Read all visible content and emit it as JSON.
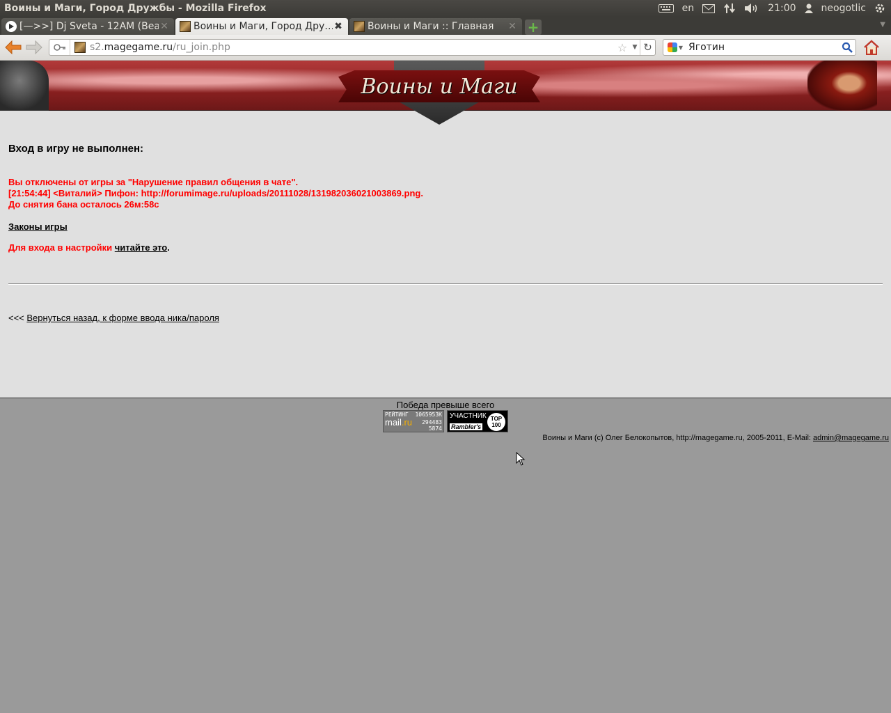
{
  "window": {
    "title": "Воины и Маги, Город Дружбы - Mozilla Firefox",
    "keyboard_layout": "en",
    "clock": "21:00",
    "user": "neogotlic",
    "tray_icons": [
      "keyboard-icon",
      "mail-icon",
      "network-icon",
      "volume-icon",
      "user-icon",
      "power-gear-icon"
    ]
  },
  "tabs": [
    {
      "label": "[—>>] Dj Sveta - 12AM (Bea…",
      "favicon": "play-icon",
      "active": false
    },
    {
      "label": "Воины и Маги, Город Дру…",
      "favicon": "game-favicon",
      "active": true
    },
    {
      "label": "Воины и Маги :: Главная",
      "favicon": "game-favicon",
      "active": false
    }
  ],
  "navbar": {
    "url_prefix": "s2.",
    "url_domain": "magegame.ru",
    "url_path": "/ru_join.php",
    "search_value": "Яготин",
    "search_engine": "google"
  },
  "banner": {
    "logo_text": "Воины и Маги"
  },
  "content": {
    "heading": "Вход в игру не выполнен:",
    "ban_line1": "Вы отключены от игры за \"Нарушение правил общения в чате\".",
    "ban_line2": "[21:54:44] <Виталий> Пифон: http://forumimage.ru/uploads/20111028/131982036021003869.png.",
    "ban_line3": "До снятия бана осталось 26м:58с",
    "rules_link": "Законы игры",
    "settings_prefix": "Для входа в настройки ",
    "settings_link": "читайте это",
    "settings_suffix": ".",
    "back_prefix": "<<< ",
    "back_link": "Вернуться назад, к форме ввода ника/пароля"
  },
  "footer": {
    "motto": "Победа превыше всего",
    "mail_counter": {
      "title": "РЕЙТИНГ",
      "value1": "1065953К",
      "brand_a": "mail",
      "brand_b": ".ru",
      "value2": "294483",
      "value3": "5874"
    },
    "rambler_counter": {
      "top_text": "УЧАСТНИК",
      "bottom_text": "Rambler's",
      "badge_line1": "TOP",
      "badge_line2": "100"
    },
    "copyright_text": "Воины и Маги (c) Олег Белокопытов, http://magegame.ru, 2005-2011, E-Mail: ",
    "email": "admin@magegame.ru"
  },
  "colors": {
    "ban_text": "#ff0000",
    "content_bg": "#e0e0e0",
    "page_bg": "#9a9a9a",
    "titlebar_bg": "#3c3b37",
    "back_arrow": "#e06a1a"
  }
}
